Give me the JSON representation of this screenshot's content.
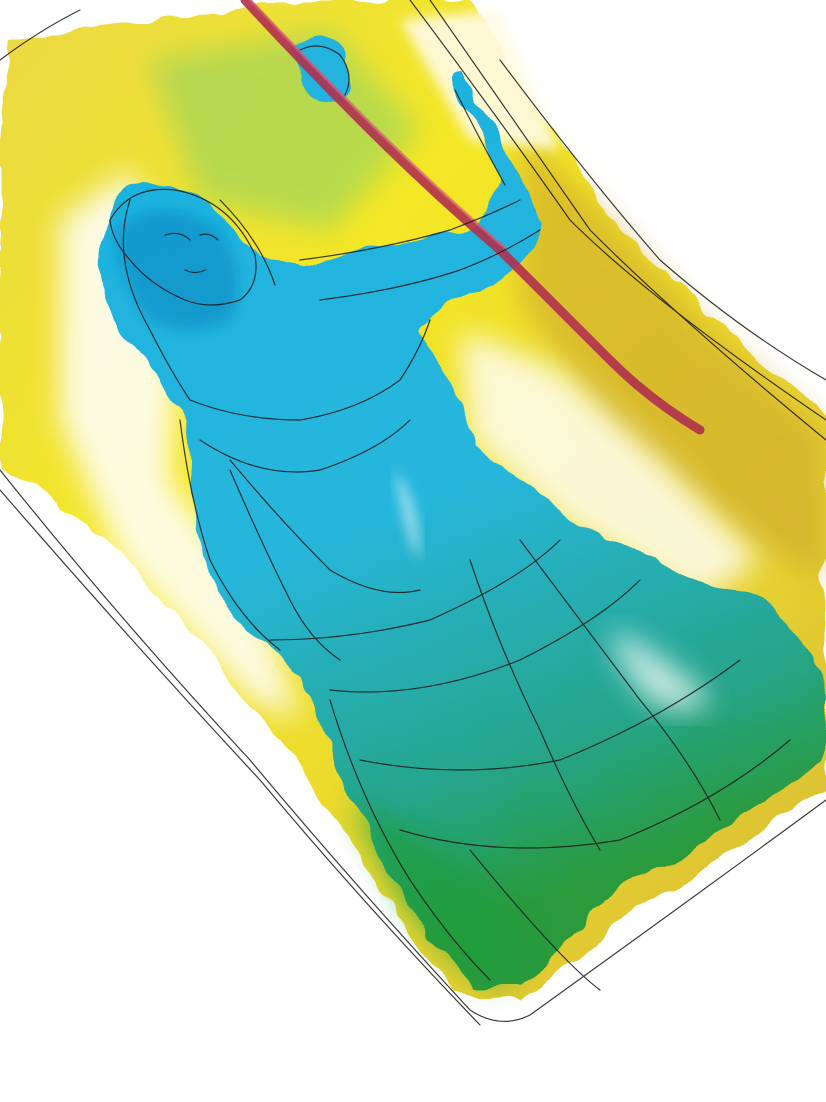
{
  "artwork": {
    "paper_color": "#ffffff",
    "palette": {
      "frame_yellow": "#f2e21a",
      "frame_ochre": "#c9a12a",
      "figure_cyan": "#1fb3dd",
      "figure_deep": "#1290c8",
      "robe_green": "#3aa84a",
      "staff_crimson": "#b0304f",
      "ink": "#1a1a1a"
    },
    "elements": [
      "watercolor-frame",
      "robed-figure",
      "staff",
      "ink-linework"
    ]
  }
}
